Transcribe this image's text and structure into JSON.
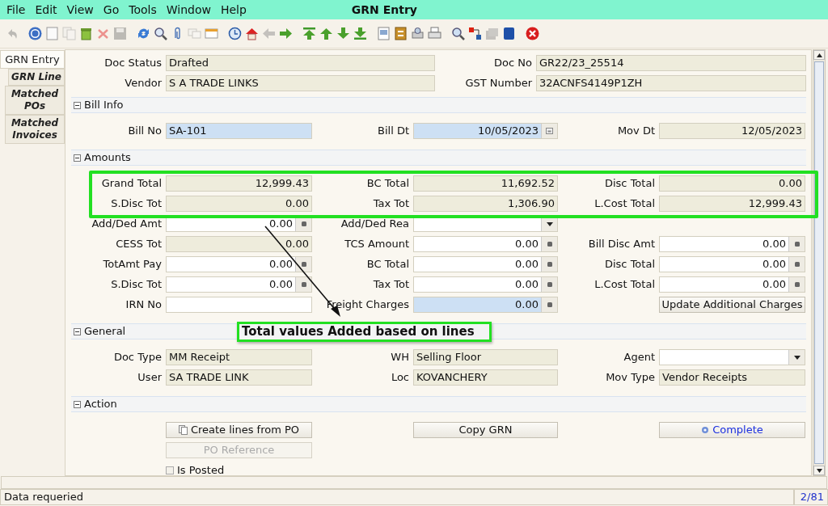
{
  "window": {
    "title": "GRN Entry"
  },
  "menu": [
    "File",
    "Edit",
    "View",
    "Go",
    "Tools",
    "Window",
    "Help"
  ],
  "toolbar": [
    [
      {
        "disabled": true
      }
    ],
    [
      {
        "disabled": false
      },
      {
        "disabled": false
      },
      {
        "disabled": true
      },
      {
        "disabled": false
      },
      {
        "disabled": true
      },
      {
        "disabled": true
      }
    ],
    [
      {
        "disabled": false
      },
      {
        "disabled": false
      },
      {
        "disabled": false
      },
      {
        "disabled": true
      },
      {
        "disabled": false
      }
    ],
    [
      {
        "disabled": false
      },
      {
        "disabled": false
      },
      {
        "disabled": true
      },
      {
        "disabled": false
      }
    ],
    [
      {
        "disabled": false
      },
      {
        "disabled": false
      },
      {
        "disabled": false
      },
      {
        "disabled": false
      }
    ],
    [
      {
        "disabled": false
      },
      {
        "disabled": false
      },
      {
        "disabled": false
      },
      {
        "disabled": false
      }
    ],
    [
      {
        "disabled": false
      },
      {
        "disabled": false
      },
      {
        "disabled": true
      },
      {
        "disabled": false
      }
    ],
    [
      {
        "disabled": false
      }
    ]
  ],
  "tabs": [
    {
      "label": "GRN Entry",
      "selected": true
    },
    {
      "label": "GRN Line",
      "selected": false
    },
    {
      "label": "Matched POs",
      "selected": false
    },
    {
      "label": "Matched Invoices",
      "selected": false
    }
  ],
  "header_fields": [
    [
      {
        "kind": "text",
        "label": "Doc Status",
        "value": "Drafted",
        "readonly": true,
        "mandatory": false
      },
      {
        "kind": "text",
        "label": "Doc No",
        "value": "GR22/23_25514",
        "readonly": true,
        "mandatory": false
      }
    ],
    [
      {
        "kind": "text",
        "label": "Vendor",
        "value": "S A TRADE LINKS",
        "readonly": true,
        "mandatory": false
      },
      {
        "kind": "text",
        "label": "GST Number",
        "value": "32ACNFS4149P1ZH",
        "readonly": true,
        "mandatory": false
      }
    ]
  ],
  "sections": [
    {
      "title": "Bill Info",
      "expanded": true,
      "rows": [
        [
          {
            "kind": "text",
            "label": "Bill No",
            "value": "SA-101",
            "readonly": false,
            "mandatory": true
          },
          {
            "kind": "date",
            "label": "Bill Dt",
            "value": "10/05/2023",
            "readonly": false,
            "mandatory": true
          },
          {
            "kind": "date",
            "label": "Mov Dt",
            "value": "12/05/2023",
            "readonly": true,
            "mandatory": false
          }
        ]
      ]
    },
    {
      "title": "Amounts",
      "expanded": true,
      "rows": [
        [
          {
            "kind": "amount",
            "label": "Grand Total",
            "value": "12,999.43",
            "readonly": true,
            "mandatory": false
          },
          {
            "kind": "amount",
            "label": "BC Total",
            "value": "11,692.52",
            "readonly": true,
            "mandatory": false
          },
          {
            "kind": "amount",
            "label": "Disc Total",
            "value": "0.00",
            "readonly": true,
            "mandatory": false
          }
        ],
        [
          {
            "kind": "amount",
            "label": "S.Disc Tot",
            "value": "0.00",
            "readonly": true,
            "mandatory": false
          },
          {
            "kind": "amount",
            "label": "Tax Tot",
            "value": "1,306.90",
            "readonly": true,
            "mandatory": false
          },
          {
            "kind": "amount",
            "label": "L.Cost Total",
            "value": "12,999.43",
            "readonly": true,
            "mandatory": false
          }
        ],
        [
          {
            "kind": "amount",
            "label": "Add/Ded Amt",
            "value": "0.00",
            "readonly": false,
            "mandatory": false
          },
          {
            "kind": "dropdown",
            "label": "Add/Ded Rea",
            "readonly": false,
            "mandatory": false
          },
          {
            "kind": "empty"
          }
        ],
        [
          {
            "kind": "amount",
            "label": "CESS Tot",
            "value": "0.00",
            "readonly": true,
            "mandatory": false
          },
          {
            "kind": "amount",
            "label": "TCS Amount",
            "value": "0.00",
            "readonly": false,
            "mandatory": false
          },
          {
            "kind": "amount",
            "label": "Bill Disc Amt",
            "value": "0.00",
            "readonly": false,
            "mandatory": false
          }
        ],
        [
          {
            "kind": "amount",
            "label": "TotAmt Pay",
            "value": "0.00",
            "readonly": false,
            "mandatory": false
          },
          {
            "kind": "amount",
            "label": "BC Total",
            "value": "0.00",
            "readonly": false,
            "mandatory": false
          },
          {
            "kind": "amount",
            "label": "Disc Total",
            "value": "0.00",
            "readonly": false,
            "mandatory": false
          }
        ],
        [
          {
            "kind": "amount",
            "label": "S.Disc Tot",
            "value": "0.00",
            "readonly": false,
            "mandatory": false
          },
          {
            "kind": "amount",
            "label": "Tax Tot",
            "value": "0.00",
            "readonly": false,
            "mandatory": false
          },
          {
            "kind": "amount",
            "label": "L.Cost Total",
            "value": "0.00",
            "readonly": false,
            "mandatory": false
          }
        ],
        [
          {
            "kind": "text",
            "label": "IRN No",
            "readonly": false,
            "mandatory": false
          },
          {
            "kind": "amount",
            "label": "Freight Charges",
            "value": "0.00",
            "readonly": false,
            "mandatory": true
          },
          {
            "kind": "button",
            "label": "Update Additional Charges",
            "disabled": false,
            "highlighted": false
          }
        ]
      ]
    },
    {
      "title": "General",
      "expanded": true,
      "rows": [
        [
          {
            "kind": "text",
            "label": "Doc Type",
            "value": "MM Receipt",
            "readonly": true,
            "mandatory": false
          },
          {
            "kind": "text",
            "label": "WH",
            "value": "Selling Floor",
            "readonly": true,
            "mandatory": false
          },
          {
            "kind": "dropdown",
            "label": "Agent",
            "readonly": false,
            "mandatory": false
          }
        ],
        [
          {
            "kind": "text",
            "label": "User",
            "value": "SA TRADE LINK",
            "readonly": true,
            "mandatory": false
          },
          {
            "kind": "text",
            "label": "Loc",
            "value": "KOVANCHERY",
            "readonly": true,
            "mandatory": false
          },
          {
            "kind": "text",
            "label": "Mov Type",
            "value": "Vendor Receipts",
            "readonly": true,
            "mandatory": false
          }
        ]
      ]
    },
    {
      "title": "Action",
      "expanded": true,
      "rows": [
        [
          {
            "kind": "button",
            "label": "Create lines from PO",
            "disabled": false,
            "highlighted": false
          },
          {
            "kind": "button",
            "label": "Copy GRN",
            "disabled": false,
            "highlighted": false
          },
          {
            "kind": "button",
            "label": "Complete",
            "disabled": false,
            "highlighted": true
          }
        ],
        [
          {
            "kind": "button",
            "label": "PO Reference",
            "disabled": true,
            "highlighted": false
          },
          {
            "kind": "empty"
          },
          {
            "kind": "empty"
          }
        ],
        [
          {
            "kind": "checkbox",
            "label": "Is Posted",
            "checked": false
          },
          {
            "kind": "empty"
          },
          {
            "kind": "empty"
          }
        ]
      ]
    }
  ],
  "annotation": {
    "text": "Total values Added based on lines"
  },
  "status_bar": {
    "message": "Data requeried",
    "record": "2/81"
  }
}
